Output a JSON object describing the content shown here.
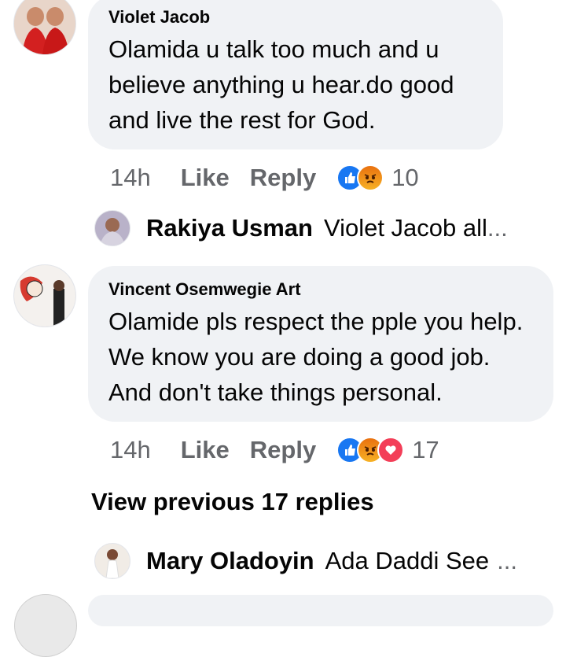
{
  "comments": [
    {
      "author": "Violet Jacob",
      "text": "Olamida u talk too much and u believe anything u hear.do good and live the rest for God.",
      "time": "14h",
      "like_label": "Like",
      "reply_label": "Reply",
      "reaction_count": "10",
      "reactions": [
        "like",
        "angry"
      ],
      "reply_preview": {
        "name": "Rakiya Usman",
        "text": "Violet Jacob all",
        "ellipsis": "..."
      }
    },
    {
      "author": "Vincent Osemwegie Art",
      "text": "Olamide pls respect the pple you help. We know you are doing a good job. And don't take things personal.",
      "time": "14h",
      "like_label": "Like",
      "reply_label": "Reply",
      "reaction_count": "17",
      "reactions": [
        "like",
        "angry",
        "love"
      ],
      "view_previous": "View previous 17 replies",
      "reply_preview": {
        "name": "Mary Oladoyin",
        "text": "Ada Daddi See",
        "ellipsis": "..."
      }
    }
  ],
  "colors": {
    "bubble": "#f0f2f5",
    "meta": "#65676b",
    "like": "#1877f2",
    "angry": "#e9710f",
    "love": "#f33e58"
  }
}
